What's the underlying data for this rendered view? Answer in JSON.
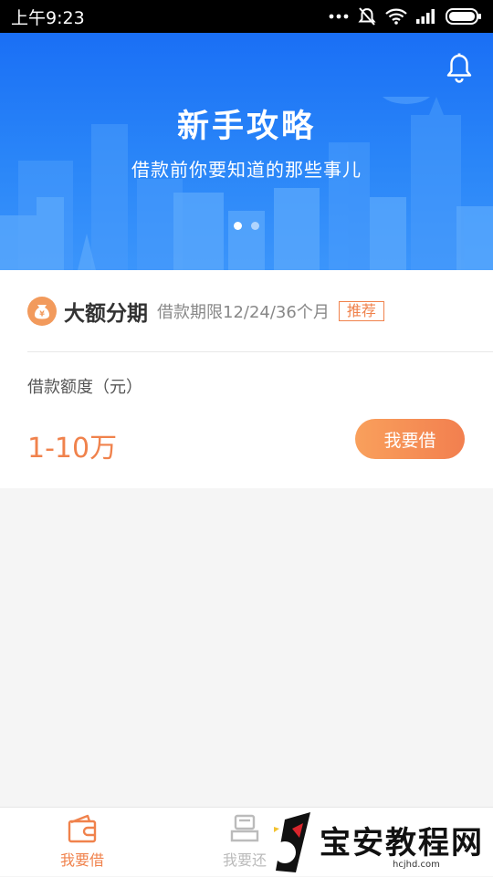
{
  "status_bar": {
    "time": "上午9:23",
    "icons": [
      "more-dots-icon",
      "alarm-off-icon",
      "wifi-icon",
      "signal-icon",
      "battery-icon"
    ]
  },
  "banner": {
    "title": "新手攻略",
    "subtitle": "借款前你要知道的那些事儿",
    "page_count": 2,
    "active_page": 1
  },
  "product": {
    "icon": "money-bag-icon",
    "name": "大额分期",
    "term": "借款期限12/24/36个月",
    "tag": "推荐",
    "amount_label": "借款额度（元）",
    "amount_value": "1-10万",
    "button_label": "我要借"
  },
  "tab_bar": {
    "tabs": [
      {
        "label": "我要借",
        "icon": "wallet-icon",
        "active": true
      },
      {
        "label": "我要还",
        "icon": "repay-icon",
        "active": false
      }
    ]
  },
  "watermark": {
    "text": "宝安教程网",
    "url": "hcjhd.com"
  },
  "colors": {
    "accent": "#f0824c",
    "banner_blue": "#1a6ff5"
  }
}
